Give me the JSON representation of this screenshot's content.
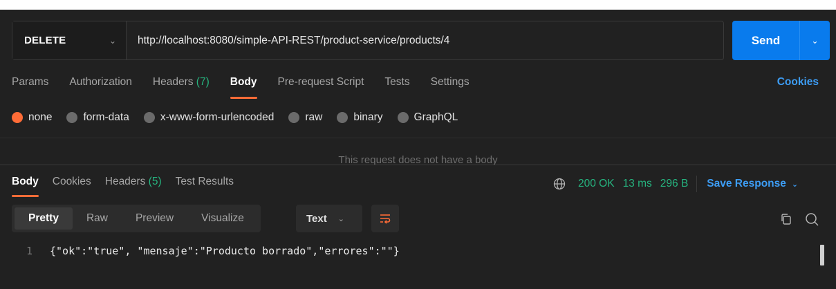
{
  "request": {
    "method": "DELETE",
    "url": "http://localhost:8080/simple-API-REST/product-service/products/4",
    "send_label": "Send"
  },
  "request_tabs": [
    {
      "label": "Params",
      "count": ""
    },
    {
      "label": "Authorization",
      "count": ""
    },
    {
      "label": "Headers",
      "count": "(7)"
    },
    {
      "label": "Body",
      "count": ""
    },
    {
      "label": "Pre-request Script",
      "count": ""
    },
    {
      "label": "Tests",
      "count": ""
    },
    {
      "label": "Settings",
      "count": ""
    }
  ],
  "cookies_link": "Cookies",
  "body_types": [
    {
      "label": "none",
      "checked": true
    },
    {
      "label": "form-data",
      "checked": false
    },
    {
      "label": "x-www-form-urlencoded",
      "checked": false
    },
    {
      "label": "raw",
      "checked": false
    },
    {
      "label": "binary",
      "checked": false
    },
    {
      "label": "GraphQL",
      "checked": false
    }
  ],
  "no_body_message": "This request does not have a body",
  "response_tabs": [
    {
      "label": "Body",
      "count": ""
    },
    {
      "label": "Cookies",
      "count": ""
    },
    {
      "label": "Headers",
      "count": "(5)"
    },
    {
      "label": "Test Results",
      "count": ""
    }
  ],
  "response_meta": {
    "status": "200 OK",
    "time": "13 ms",
    "size": "296 B",
    "save_label": "Save Response"
  },
  "view_modes": [
    "Pretty",
    "Raw",
    "Preview",
    "Visualize"
  ],
  "format": "Text",
  "code": {
    "line_number": "1",
    "text": "{\"ok\":\"true\", \"mensaje\":\"Producto borrado\",\"errores\":\"\"}"
  },
  "colors": {
    "accent": "#ff6c37",
    "send": "#097bed",
    "status_ok": "#26b47f",
    "link": "#3d9df5"
  }
}
